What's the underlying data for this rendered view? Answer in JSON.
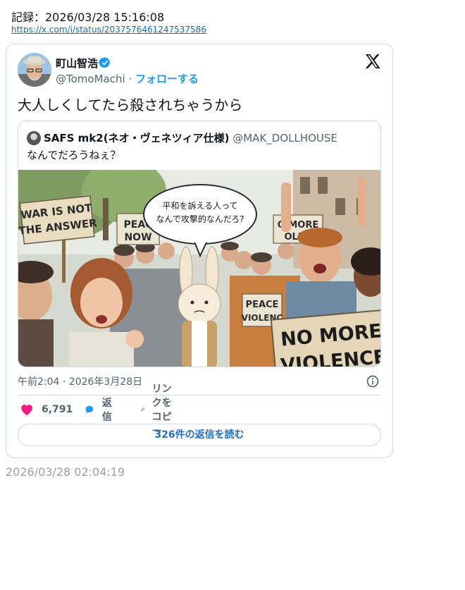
{
  "record": {
    "label": "記録：2026/03/28 15:16:08",
    "url": "https://x.com/i/status/2037576461247537586"
  },
  "tweet": {
    "author_name": "町山智浩",
    "handle": "@TomoMachi",
    "separator": " · ",
    "follow_label": "フォローする",
    "text": "大人しくしてたら殺されちゃうから",
    "timestamp": "午前2:04 · 2026年3月28日",
    "likes": "6,791",
    "reply_label": "返信",
    "copy_link_label": "リンクをコピー",
    "read_replies_label": "326件の返信を読む"
  },
  "quote": {
    "author_name": "SAFS mk2(ネオ・ヴェネツィア仕様)",
    "handle": "@MAK_DOLLHOUSE",
    "text": "なんでだろうねぇ？",
    "image": {
      "speech_bubble_line1": "平和を訴える人って",
      "speech_bubble_line2": "なんで攻撃的なんだろ?",
      "sign_war_line1": "WAR IS NOT",
      "sign_war_line2": "THE ANSWER",
      "sign_peace_line1": "PEAC",
      "sign_peace_line2": "NOW",
      "sign_more_line1": "O MORE",
      "sign_more_line2": "OLEN",
      "sign_peace2_line1": "PEACE",
      "sign_peace2_line2": "VIOLENC",
      "sign_big_line1": "NO MORE",
      "sign_big_line2": "VIOLENCE"
    }
  },
  "footer": {
    "time": "2026/03/28 02:04:19"
  },
  "colors": {
    "accent": "#1d9bf0",
    "like": "#f91880",
    "muted": "#536471",
    "border": "#cfd9de"
  }
}
